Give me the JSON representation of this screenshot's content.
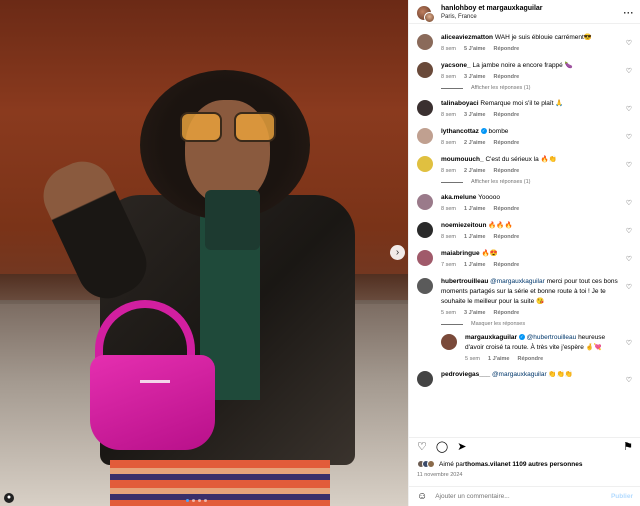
{
  "post": {
    "authors": "hanlohboy et margauxkaguilar",
    "location": "Paris, France"
  },
  "comments": [
    {
      "user": "aliceaviezmatton",
      "text": "WAH je suis éblouie carrément😎",
      "age": "8 sem",
      "likes": "5 J'aime",
      "reply": "Répondre",
      "avatar_color": "#8a6a5a"
    },
    {
      "user": "yacsone_",
      "text": "La jambe noire a encore frappé 🍆",
      "age": "8 sem",
      "likes": "3 J'aime",
      "reply": "Répondre",
      "avatar_color": "#6a4a3a",
      "replies_label": "Afficher les réponses (1)"
    },
    {
      "user": "talinaboyaci",
      "text": "Remarque moi s'il te plaît 🙏",
      "age": "8 sem",
      "likes": "3 J'aime",
      "reply": "Répondre",
      "avatar_color": "#3a3030"
    },
    {
      "user": "lythancottaz",
      "verified": true,
      "text": "bombe",
      "age": "8 sem",
      "likes": "2 J'aime",
      "reply": "Répondre",
      "avatar_color": "#c0a090"
    },
    {
      "user": "moumouuch_",
      "text": "C'est du sérieux la 🔥👏",
      "age": "8 sem",
      "likes": "2 J'aime",
      "reply": "Répondre",
      "avatar_color": "#e0c040",
      "replies_label": "Afficher les réponses (1)"
    },
    {
      "user": "aka.melune",
      "text": "Yooooo",
      "age": "8 sem",
      "likes": "1 J'aime",
      "reply": "Répondre",
      "avatar_color": "#9a7a8a"
    },
    {
      "user": "noemiezeitoun",
      "text": "🔥🔥🔥",
      "age": "8 sem",
      "likes": "1 J'aime",
      "reply": "Répondre",
      "avatar_color": "#2a2a2a"
    },
    {
      "user": "maiabringue",
      "text": "🔥😍",
      "age": "7 sem",
      "likes": "1 J'aime",
      "reply": "Répondre",
      "avatar_color": "#a05a6a"
    },
    {
      "user": "hubertrouilleau",
      "mention": "@margauxkaguilar",
      "text": " merci pour tout ces bons moments partagés sur la série et bonne route à toi ! Je te souhaite le meilleur pour la suite 😘",
      "age": "5 sem",
      "likes": "3 J'aime",
      "reply": "Répondre",
      "avatar_color": "#5a5a5a",
      "replies_label": "Masquer les réponses"
    }
  ],
  "nested_reply": {
    "user": "margauxkaguilar",
    "verified": true,
    "mention": "@hubertrouilleau",
    "text": " heureuse d'avoir croisé ta route. À très vite j'espère 🤞💘",
    "age": "5 sem",
    "likes": "1 J'aime",
    "reply": "Répondre",
    "avatar_color": "#7a4a3a"
  },
  "last_comment": {
    "user": "pedroviegas___",
    "mention": "@margauxkaguilar",
    "text": " 👏👏👏",
    "avatar_color": "#444"
  },
  "footer": {
    "liked_by_prefix": "Aimé par ",
    "liked_by_user": "thomas.vilan",
    "liked_by_suffix": " et 1109 autres personnes",
    "date": "11 novembre 2024",
    "add_comment_placeholder": "Ajouter un commentaire...",
    "publish": "Publier"
  },
  "icons": {
    "more": "more-icon",
    "like": "heart-icon",
    "comment": "comment-icon",
    "share": "share-icon",
    "save": "bookmark-icon",
    "emoji": "emoji-icon",
    "next": "chevron-right-icon"
  },
  "colors": {
    "link": "#00376b",
    "verified": "#0095f6",
    "muted": "#737373",
    "publish_disabled": "#b3dbff"
  }
}
